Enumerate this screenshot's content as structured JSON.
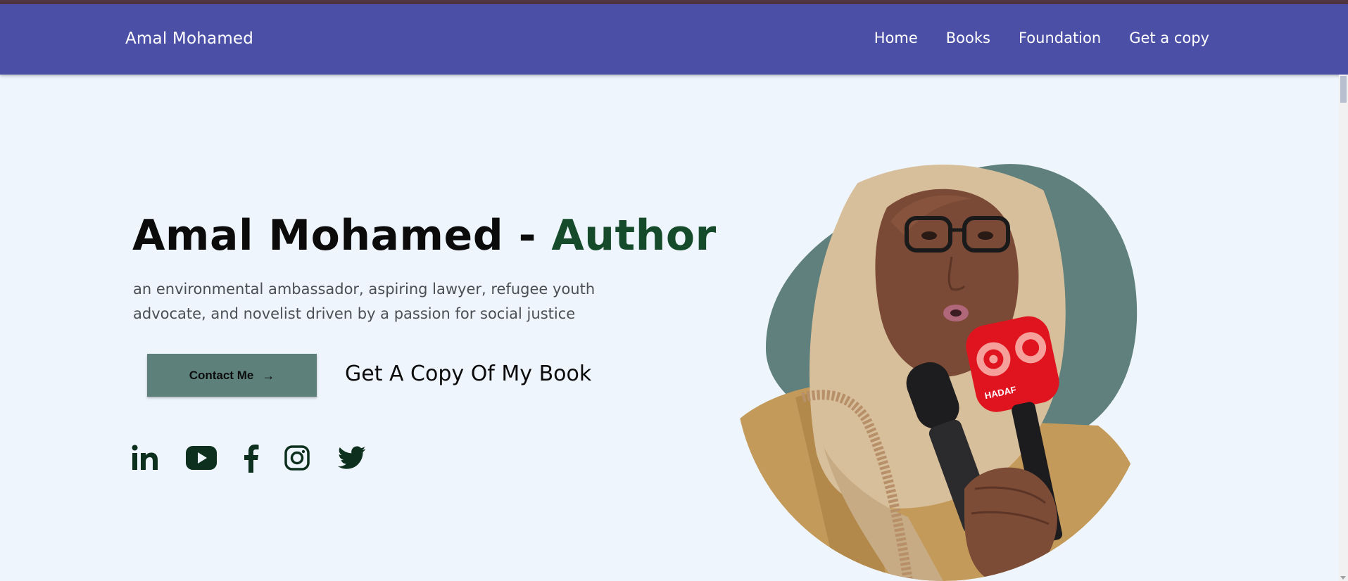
{
  "nav": {
    "brand": "Amal Mohamed",
    "links": [
      "Home",
      "Books",
      "Foundation",
      "Get a copy"
    ]
  },
  "hero": {
    "title_main": "Amal Mohamed - ",
    "title_accent": "Author",
    "subtitle": "an environmental ambassador, aspiring lawyer, refugee youth advocate, and novelist driven by a passion for social justice",
    "contact_button": "Contact Me",
    "book_link": "Get A Copy Of My Book",
    "microphone_logo_text": "HADAF"
  },
  "socials": [
    {
      "name": "linkedin-icon"
    },
    {
      "name": "youtube-icon"
    },
    {
      "name": "facebook-icon"
    },
    {
      "name": "instagram-icon"
    },
    {
      "name": "twitter-icon"
    }
  ],
  "colors": {
    "navbar": "#4b50a6",
    "topbar": "#4f3540",
    "background": "#eff5fd",
    "accent_green": "#154b2b",
    "button": "#5d807b",
    "blob": "#5f807c",
    "social_icon": "#0d2f1d"
  }
}
